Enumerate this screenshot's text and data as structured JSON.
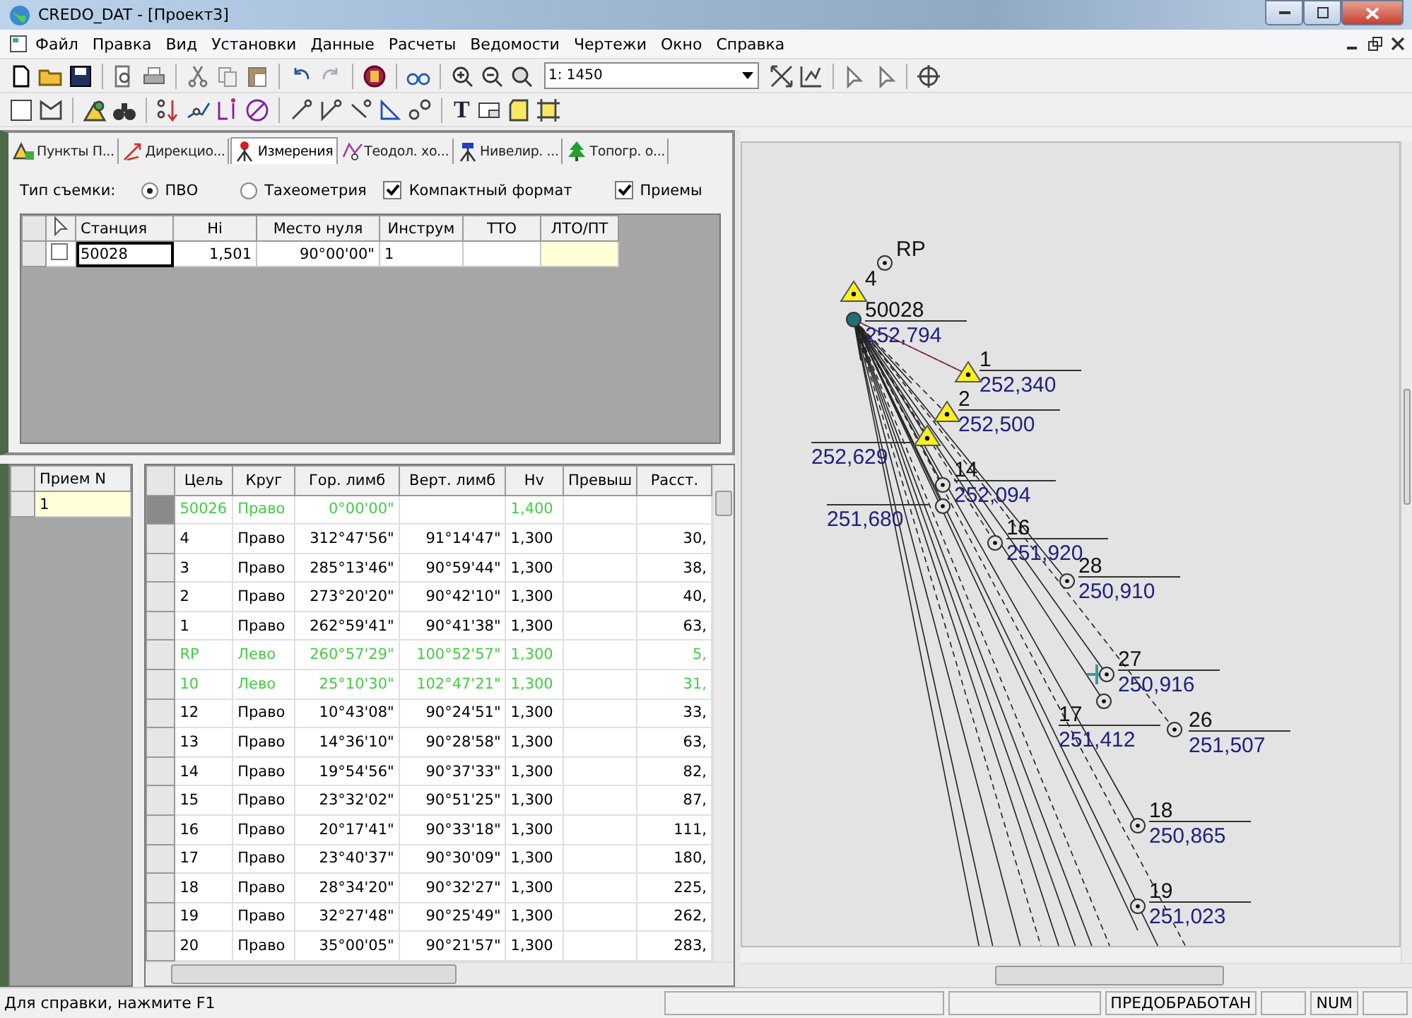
{
  "window": {
    "title": "CREDO_DAT - [Проект3]"
  },
  "menu": [
    "Файл",
    "Правка",
    "Вид",
    "Установки",
    "Данные",
    "Расчеты",
    "Ведомости",
    "Чертежи",
    "Окно",
    "Справка"
  ],
  "toolbar": {
    "scale": "1: 1450",
    "text_tool": "T"
  },
  "tabs": [
    {
      "label": "Пункты П...",
      "selected": false
    },
    {
      "label": "Дирекцио...",
      "selected": false
    },
    {
      "label": "Измерения",
      "selected": true
    },
    {
      "label": "Теодол. хо...",
      "selected": false
    },
    {
      "label": "Нивелир. ...",
      "selected": false
    },
    {
      "label": "Топогр. о...",
      "selected": false
    }
  ],
  "survey_type": {
    "label": "Тип съемки:",
    "options": [
      {
        "label": "ПВО",
        "selected": true
      },
      {
        "label": "Тахеометрия",
        "selected": false
      }
    ]
  },
  "checkboxes": [
    {
      "label": "Компактный формат",
      "checked": true
    },
    {
      "label": "Приемы",
      "checked": true
    }
  ],
  "stations_table": {
    "columns": [
      "Станция",
      "Hi",
      "Место нуля",
      "Инструм",
      "ТТО",
      "ЛТО/ПТ"
    ],
    "rows": [
      {
        "checked": false,
        "cells": [
          "50028",
          "1,501",
          "90°00'00\"",
          "1"
        ]
      }
    ]
  },
  "sets_table": {
    "column": "Прием N",
    "rows": [
      {
        "value": "1",
        "selected": true
      }
    ]
  },
  "observations_table": {
    "columns": [
      "Цель",
      "Круг",
      "Гор. лимб",
      "Верт. лимб",
      "Hv",
      "Превыш",
      "Расст."
    ],
    "rows": [
      {
        "color": "#44cc44",
        "target": "50026",
        "face": "Право",
        "hz": "0°00'00\"",
        "hv": "1,400"
      },
      {
        "color": "#000000",
        "target": "4",
        "face": "Право",
        "hz": "312°47'56\"",
        "vt": "91°14'47\"",
        "hv": "1,300",
        "dist": "30,"
      },
      {
        "color": "#000000",
        "target": "3",
        "face": "Право",
        "hz": "285°13'46\"",
        "vt": "90°59'44\"",
        "hv": "1,300",
        "dist": "38,"
      },
      {
        "color": "#000000",
        "target": "2",
        "face": "Право",
        "hz": "273°20'20\"",
        "vt": "90°42'10\"",
        "hv": "1,300",
        "dist": "40,"
      },
      {
        "color": "#000000",
        "target": "1",
        "face": "Право",
        "hz": "262°59'41\"",
        "vt": "90°41'38\"",
        "hv": "1,300",
        "dist": "63,"
      },
      {
        "color": "#44cc44",
        "target": "RP",
        "face": "Лево",
        "hz": "260°57'29\"",
        "vt": "100°52'57\"",
        "hv": "1,300",
        "dist": "5,"
      },
      {
        "color": "#44cc44",
        "target": "10",
        "face": "Лево",
        "hz": "25°10'30\"",
        "vt": "102°47'21\"",
        "hv": "1,300",
        "dist": "31,"
      },
      {
        "color": "#000000",
        "target": "12",
        "face": "Право",
        "hz": "10°43'08\"",
        "vt": "90°24'51\"",
        "hv": "1,300",
        "dist": "33,"
      },
      {
        "color": "#000000",
        "target": "13",
        "face": "Право",
        "hz": "14°36'10\"",
        "vt": "90°28'58\"",
        "hv": "1,300",
        "dist": "63,"
      },
      {
        "color": "#000000",
        "target": "14",
        "face": "Право",
        "hz": "19°54'56\"",
        "vt": "90°37'33\"",
        "hv": "1,300",
        "dist": "82,"
      },
      {
        "color": "#000000",
        "target": "15",
        "face": "Право",
        "hz": "23°32'02\"",
        "vt": "90°51'25\"",
        "hv": "1,300",
        "dist": "87,"
      },
      {
        "color": "#000000",
        "target": "16",
        "face": "Право",
        "hz": "20°17'41\"",
        "vt": "90°33'18\"",
        "hv": "1,300",
        "dist": "111,"
      },
      {
        "color": "#000000",
        "target": "17",
        "face": "Право",
        "hz": "23°40'37\"",
        "vt": "90°30'09\"",
        "hv": "1,300",
        "dist": "180,"
      },
      {
        "color": "#000000",
        "target": "18",
        "face": "Право",
        "hz": "28°34'20\"",
        "vt": "90°32'27\"",
        "hv": "1,300",
        "dist": "225,"
      },
      {
        "color": "#000000",
        "target": "19",
        "face": "Право",
        "hz": "32°27'48\"",
        "vt": "90°25'49\"",
        "hv": "1,300",
        "dist": "262,"
      },
      {
        "color": "#000000",
        "target": "20",
        "face": "Право",
        "hz": "35°00'05\"",
        "vt": "90°21'57\"",
        "hv": "1,300",
        "dist": "283,"
      }
    ]
  },
  "plan": {
    "points": [
      {
        "kind": "circle",
        "name": "RP"
      },
      {
        "kind": "triangle",
        "name": "4"
      },
      {
        "kind": "station",
        "name": "50028",
        "elevation": "252,794"
      },
      {
        "kind": "triangle",
        "name": "1",
        "elevation": "252,340"
      },
      {
        "kind": "triangle",
        "name": "2",
        "elevation": "252,500"
      },
      {
        "kind": "triangle",
        "elevation": "252,629"
      },
      {
        "kind": "circle",
        "name": "14",
        "elevation": "252,094"
      },
      {
        "kind": "circle",
        "elevation": "251,680"
      },
      {
        "kind": "circle",
        "name": "16",
        "elevation": "251,920"
      },
      {
        "kind": "circle",
        "name": "28",
        "elevation": "250,910"
      },
      {
        "kind": "circle",
        "name": "27",
        "elevation": "250,916"
      },
      {
        "kind": "circle",
        "name": "17",
        "elevation": "251,412"
      },
      {
        "kind": "circle",
        "name": "26",
        "elevation": "251,507"
      },
      {
        "kind": "circle",
        "name": "18",
        "elevation": "250,865"
      },
      {
        "kind": "circle",
        "name": "19",
        "elevation": "251,023"
      }
    ]
  },
  "status_bar": {
    "hint": "Для справки, нажмите F1",
    "panels": [
      "ПРЕДОБРАБОТАН",
      "NUM"
    ]
  }
}
